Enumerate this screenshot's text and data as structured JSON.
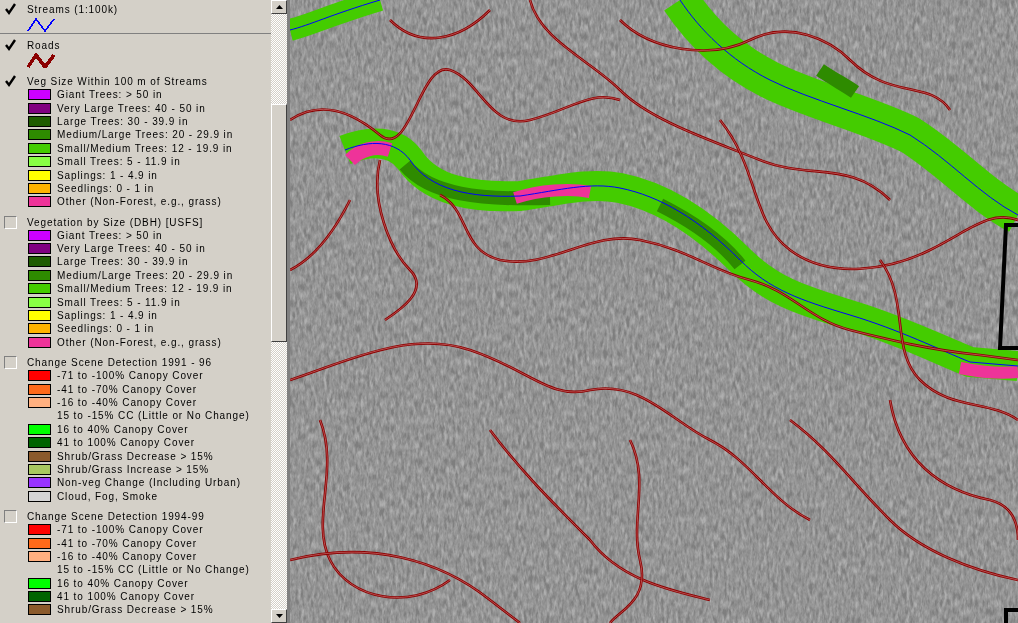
{
  "legend": {
    "layers": [
      {
        "name": "Streams (1:100k)",
        "checked": true,
        "kind": "line",
        "color": "#0000ff",
        "double": false
      },
      {
        "name": "Roads",
        "checked": true,
        "kind": "line",
        "color": "#8b0000",
        "double": true
      },
      {
        "name": "Veg Size Within 100 m of Streams",
        "checked": true,
        "kind": "classes",
        "classes": [
          {
            "label": "Giant Trees: > 50 in",
            "color": "#cc00ff"
          },
          {
            "label": "Very Large Trees: 40 - 50 in",
            "color": "#800080"
          },
          {
            "label": "Large Trees: 30 - 39.9 in",
            "color": "#1f5c00"
          },
          {
            "label": "Medium/Large Trees: 20 - 29.9 in",
            "color": "#2e8b00"
          },
          {
            "label": "Small/Medium Trees: 12 - 19.9 in",
            "color": "#44cc00"
          },
          {
            "label": "Small Trees: 5 - 11.9 in",
            "color": "#88ff44"
          },
          {
            "label": "Saplings: 1 - 4.9 in",
            "color": "#ffff00"
          },
          {
            "label": "Seedlings: 0 - 1 in",
            "color": "#ffb400"
          },
          {
            "label": "Other (Non-Forest, e.g., grass)",
            "color": "#ee3399"
          }
        ]
      },
      {
        "name": "Vegetation by Size (DBH) [USFS]",
        "checked": false,
        "kind": "classes",
        "classes": [
          {
            "label": "Giant Trees: > 50 in",
            "color": "#cc00ff"
          },
          {
            "label": "Very Large Trees: 40 - 50 in",
            "color": "#800080"
          },
          {
            "label": "Large Trees: 30 - 39.9 in",
            "color": "#1f5c00"
          },
          {
            "label": "Medium/Large Trees: 20 - 29.9 in",
            "color": "#2e8b00"
          },
          {
            "label": "Small/Medium Trees: 12 - 19.9 in",
            "color": "#44cc00"
          },
          {
            "label": "Small Trees: 5 - 11.9 in",
            "color": "#88ff44"
          },
          {
            "label": "Saplings: 1 - 4.9 in",
            "color": "#ffff00"
          },
          {
            "label": "Seedlings: 0 - 1 in",
            "color": "#ffb400"
          },
          {
            "label": "Other (Non-Forest, e.g., grass)",
            "color": "#ee3399"
          }
        ]
      },
      {
        "name": "Change Scene Detection 1991 - 96",
        "checked": false,
        "kind": "classes",
        "classes": [
          {
            "label": "-71 to -100% Canopy Cover",
            "color": "#ff0000"
          },
          {
            "label": "-41 to -70% Canopy Cover",
            "color": "#ff6a1a"
          },
          {
            "label": "-16 to -40% Canopy Cover",
            "color": "#ffb080"
          },
          {
            "label": "15 to -15% CC (Little or No Change)"
          },
          {
            "label": "16 to 40% Canopy Cover",
            "color": "#00ff00"
          },
          {
            "label": "41 to 100% Canopy Cover",
            "color": "#006400"
          },
          {
            "label": "Shrub/Grass Decrease > 15%",
            "color": "#8b5a2b"
          },
          {
            "label": "Shrub/Grass Increase > 15%",
            "color": "#a8c860"
          },
          {
            "label": "Non-veg Change (Including Urban)",
            "color": "#9933ff"
          },
          {
            "label": "Cloud, Fog, Smoke",
            "color": "#d4d4d4"
          }
        ]
      },
      {
        "name": "Change Scene Detection 1994-99",
        "checked": false,
        "kind": "classes",
        "classes": [
          {
            "label": "-71 to -100% Canopy Cover",
            "color": "#ff0000"
          },
          {
            "label": "-41 to -70% Canopy Cover",
            "color": "#ff6a1a"
          },
          {
            "label": "-16 to -40% Canopy Cover",
            "color": "#ffb080"
          },
          {
            "label": "15 to -15% CC (Little or No Change)"
          },
          {
            "label": "16 to 40% Canopy Cover",
            "color": "#00ff00"
          },
          {
            "label": "41 to 100% Canopy Cover",
            "color": "#006400"
          },
          {
            "label": "Shrub/Grass Decrease > 15%",
            "color": "#8b5a2b"
          }
        ]
      }
    ]
  }
}
